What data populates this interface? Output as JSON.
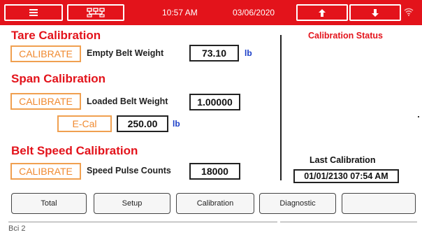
{
  "topbar": {
    "time": "10:57 AM",
    "date": "03/06/2020",
    "icons": [
      "menu-icon",
      "network-icon",
      "arrow-up-icon",
      "arrow-down-icon",
      "wifi-icon"
    ],
    "bg_color": "#e3131b"
  },
  "tare": {
    "heading": "Tare Calibration",
    "button": "CALIBRATE",
    "label": "Empty Belt Weight",
    "value": "73.10",
    "unit": "lb"
  },
  "span": {
    "heading": "Span Calibration",
    "button": "CALIBRATE",
    "label": "Loaded Belt Weight",
    "value": "1.00000",
    "ecal_button": "E-Cal",
    "ecal_value": "250.00",
    "ecal_unit": "lb"
  },
  "belt_speed": {
    "heading": "Belt Speed Calibration",
    "button": "CALIBRATE",
    "label": "Speed Pulse Counts",
    "value": "18000"
  },
  "status_panel": {
    "title": "Calibration Status",
    "last_label": "Last Calibration",
    "last_value": "01/01/2130 07:54 AM"
  },
  "nav": {
    "buttons": [
      "Total",
      "Setup",
      "Calibration",
      "Diagnostic",
      ""
    ]
  },
  "statusbar": {
    "text": "Bci 2"
  },
  "colors": {
    "heading_red": "#e3131b",
    "button_orange": "#f08a30",
    "unit_blue": "#1a3ec8"
  }
}
